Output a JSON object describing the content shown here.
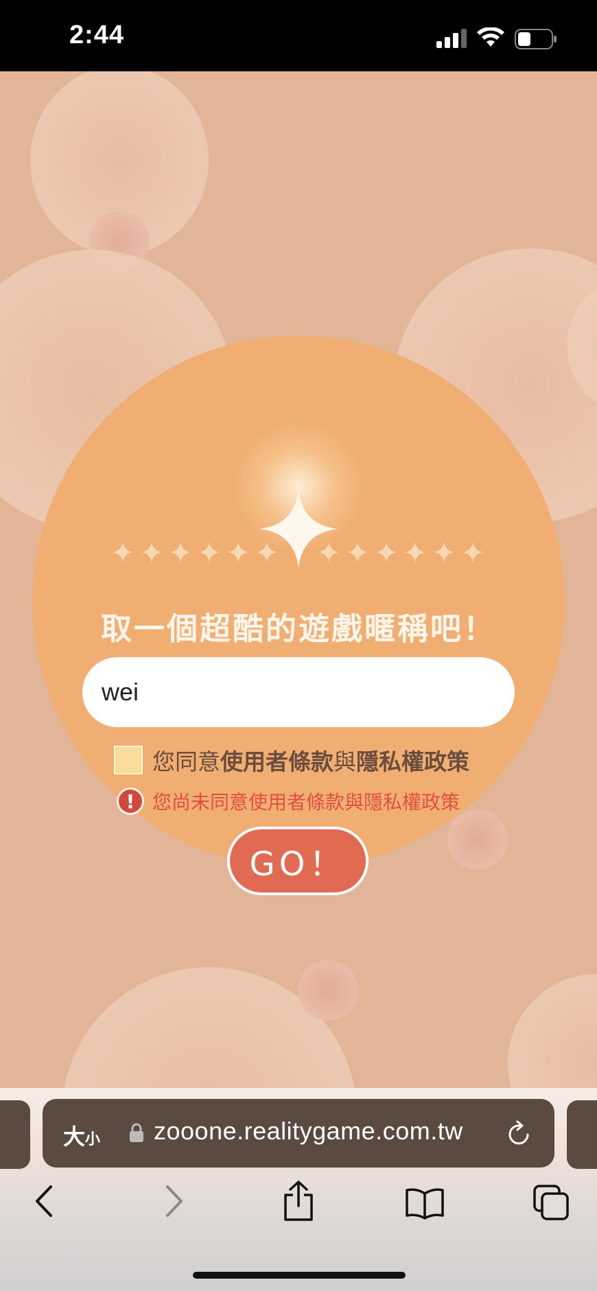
{
  "status_bar": {
    "time": "2:44"
  },
  "game": {
    "title": "取一個超酷的遊戲暱稱吧！",
    "nickname_value": "wei",
    "agree": {
      "prefix": "您同意",
      "terms": "使用者條款",
      "connector": "與",
      "privacy": "隱私權政策"
    },
    "error_icon": "!",
    "error_message": "您尚未同意使用者條款與隱私權政策",
    "go_label": "GO！",
    "colors": {
      "background": "#e2b598",
      "circle": "#f0ae72",
      "go_button": "#e06a52",
      "error": "#e05040",
      "checkbox": "#f8dc9a"
    }
  },
  "browser": {
    "text_size_label": "大",
    "text_size_small": "小",
    "url": "zooone.realitygame.com.tw",
    "icons": [
      "lock-icon",
      "reload-icon",
      "back-icon",
      "forward-icon",
      "share-icon",
      "bookmarks-icon",
      "tabs-icon"
    ]
  }
}
